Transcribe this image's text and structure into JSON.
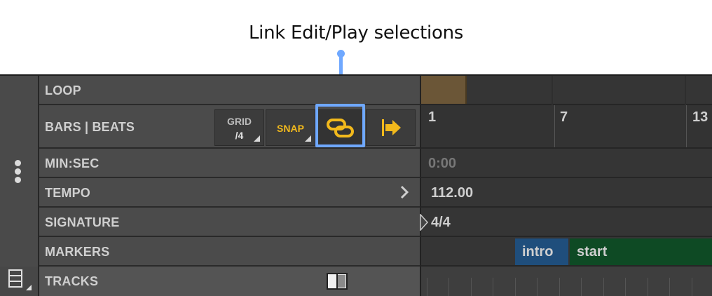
{
  "callout": {
    "text": "Link Edit/Play selections"
  },
  "rows": {
    "loop": "LOOP",
    "bars_beats": "BARS | BEATS",
    "min_sec": "MIN:SEC",
    "tempo": "TEMPO",
    "signature": "SIGNATURE",
    "markers": "MARKERS",
    "tracks": "TRACKS"
  },
  "toolbar": {
    "grid_label": "GRID",
    "grid_value": "/4",
    "snap_label": "SNAP",
    "link_icon": "link-chain-icon",
    "follow_icon": "follow-arrow-icon"
  },
  "ruler": {
    "bars": [
      "1",
      "7",
      "13"
    ],
    "time": "0:00",
    "tempo": "112.00",
    "signature": "4/4"
  },
  "markers": [
    {
      "label": "intro",
      "color": "#1f4e7c"
    },
    {
      "label": "start",
      "color": "#0e4a24"
    }
  ],
  "colors": {
    "accent": "#f2b91c",
    "callout": "#6fa8ff",
    "loop_region": "#6b5637"
  }
}
